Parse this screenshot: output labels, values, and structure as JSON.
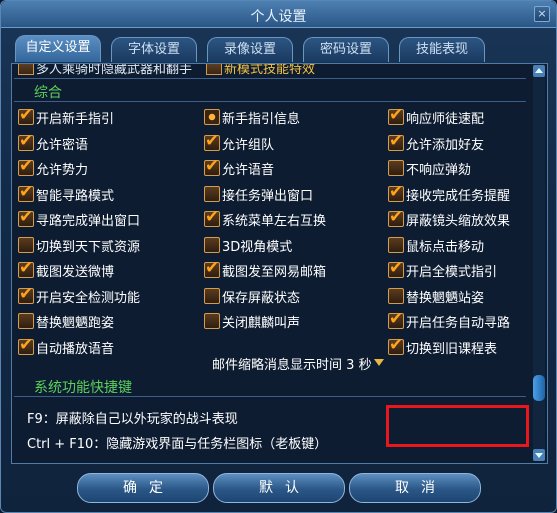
{
  "window": {
    "title": "个人设置",
    "close_label": "×"
  },
  "tabs": [
    {
      "label": "自定义设置",
      "active": true
    },
    {
      "label": "字体设置",
      "active": false
    },
    {
      "label": "录像设置",
      "active": false
    },
    {
      "label": "密码设置",
      "active": false
    },
    {
      "label": "技能表现",
      "active": false
    }
  ],
  "top_strip": {
    "left_text": "多人乘骑时隐藏武器和翻手",
    "right_text": "新模式技能特效"
  },
  "section_general": {
    "title": "综合",
    "options": [
      {
        "label": "开启新手指引",
        "checked": true
      },
      {
        "label": "新手指引信息",
        "checked": false,
        "special": true
      },
      {
        "label": "响应师徒速配",
        "checked": true
      },
      {
        "label": "允许密语",
        "checked": true
      },
      {
        "label": "允许组队",
        "checked": true
      },
      {
        "label": "允许添加好友",
        "checked": true
      },
      {
        "label": "允许势力",
        "checked": true
      },
      {
        "label": "允许语音",
        "checked": true
      },
      {
        "label": "不响应弹劾",
        "checked": false
      },
      {
        "label": "智能寻路模式",
        "checked": true
      },
      {
        "label": "接任务弹出窗口",
        "checked": false
      },
      {
        "label": "接收完成任务提醒",
        "checked": true
      },
      {
        "label": "寻路完成弹出窗口",
        "checked": true
      },
      {
        "label": "系统菜单左右互换",
        "checked": true
      },
      {
        "label": "屏蔽镜头缩放效果",
        "checked": true
      },
      {
        "label": "切换到天下贰资源",
        "checked": false
      },
      {
        "label": "3D视角模式",
        "checked": false
      },
      {
        "label": "鼠标点击移动",
        "checked": false
      },
      {
        "label": "截图发送微博",
        "checked": true
      },
      {
        "label": "截图发至网易邮箱",
        "checked": true
      },
      {
        "label": "开启全模式指引",
        "checked": true
      },
      {
        "label": "开启安全检测功能",
        "checked": true
      },
      {
        "label": "保存屏蔽状态",
        "checked": false
      },
      {
        "label": "替换魍魉站姿",
        "checked": false
      },
      {
        "label": "替换魍魉跑姿",
        "checked": false
      },
      {
        "label": "关闭麒麟叫声",
        "checked": false
      },
      {
        "label": "开启任务自动寻路",
        "checked": true
      },
      {
        "label": "自动播放语音",
        "checked": true
      },
      {
        "label": "切换到旧课程表",
        "checked": true
      }
    ],
    "mail_display": {
      "label": "邮件缩略消息显示时间",
      "value": "3",
      "unit": "秒"
    }
  },
  "section_shortcuts": {
    "title": "系统功能快捷键",
    "lines": [
      "F9：屏蔽除自己以外玩家的战斗表现",
      "Ctrl + F10：隐藏游戏界面与任务栏图标（老板键）"
    ]
  },
  "buttons": {
    "ok": "确定",
    "default": "默认",
    "cancel": "取消"
  },
  "colors": {
    "section_title": "#5bd05b",
    "check": "#ffa31a",
    "highlight_box": "#e8171b"
  }
}
